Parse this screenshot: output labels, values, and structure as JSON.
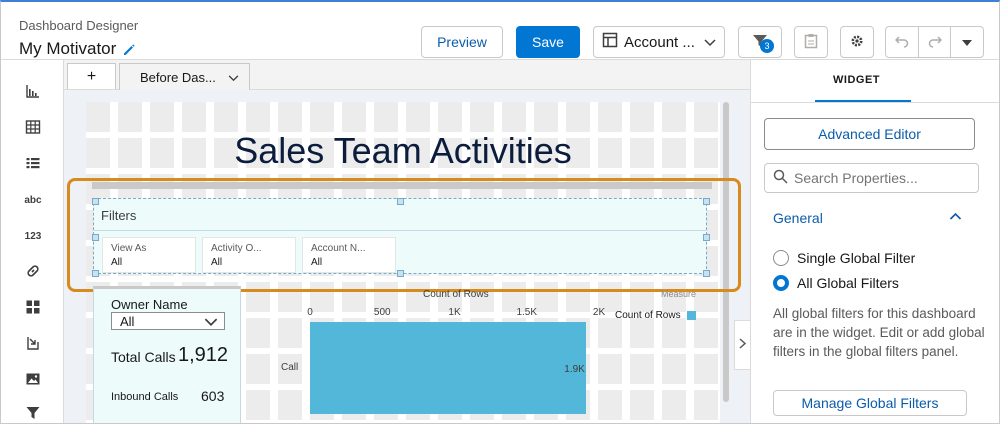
{
  "header": {
    "subtitle": "Dashboard Designer",
    "title": "My Motivator",
    "preview_label": "Preview",
    "save_label": "Save",
    "dataset_select": "Account ...",
    "filter_badge": "3"
  },
  "left_rail": {
    "text_tool": "abc",
    "number_tool": "123"
  },
  "tabs": {
    "add": "+",
    "current_page": "Before Das..."
  },
  "canvas": {
    "dashboard_title": "Sales Team Activities",
    "filter_widget": {
      "title": "Filters",
      "chips": [
        {
          "label": "View As",
          "value": "All"
        },
        {
          "label": "Activity O...",
          "value": "All"
        },
        {
          "label": "Account N...",
          "value": "All"
        }
      ]
    },
    "metrics": {
      "owner_label": "Owner Name",
      "owner_value": "All",
      "total_calls_label": "Total Calls",
      "total_calls_value": "1,912",
      "inbound_calls_label": "Inbound Calls",
      "inbound_calls_value": "603"
    }
  },
  "chart_data": {
    "type": "bar",
    "orientation": "horizontal",
    "title": "Count of Rows",
    "legend_title": "Measure",
    "legend_placement": "top-right",
    "categories": [
      "Call"
    ],
    "series": [
      {
        "name": "Count of Rows",
        "values": [
          1912
        ],
        "value_labels": [
          "1.9K"
        ]
      }
    ],
    "xlim": [
      0,
      2000
    ],
    "x_ticks": [
      "0",
      "500",
      "1K",
      "1.5K",
      "2K"
    ],
    "colors": {
      "bar": "#52b7d8"
    }
  },
  "right_panel": {
    "tab_label": "WIDGET",
    "advanced_editor_label": "Advanced Editor",
    "search_placeholder": "Search Properties...",
    "section_title": "General",
    "options": [
      {
        "label": "Single Global Filter",
        "selected": false
      },
      {
        "label": "All Global Filters",
        "selected": true
      }
    ],
    "help_text": "All global filters for this dashboard are in the widget. Edit or add global filters in the global filters panel.",
    "manage_label": "Manage Global Filters"
  },
  "colors": {
    "brand": "#0176d3",
    "highlight": "#d78a1e",
    "title": "#0b1c3d"
  }
}
